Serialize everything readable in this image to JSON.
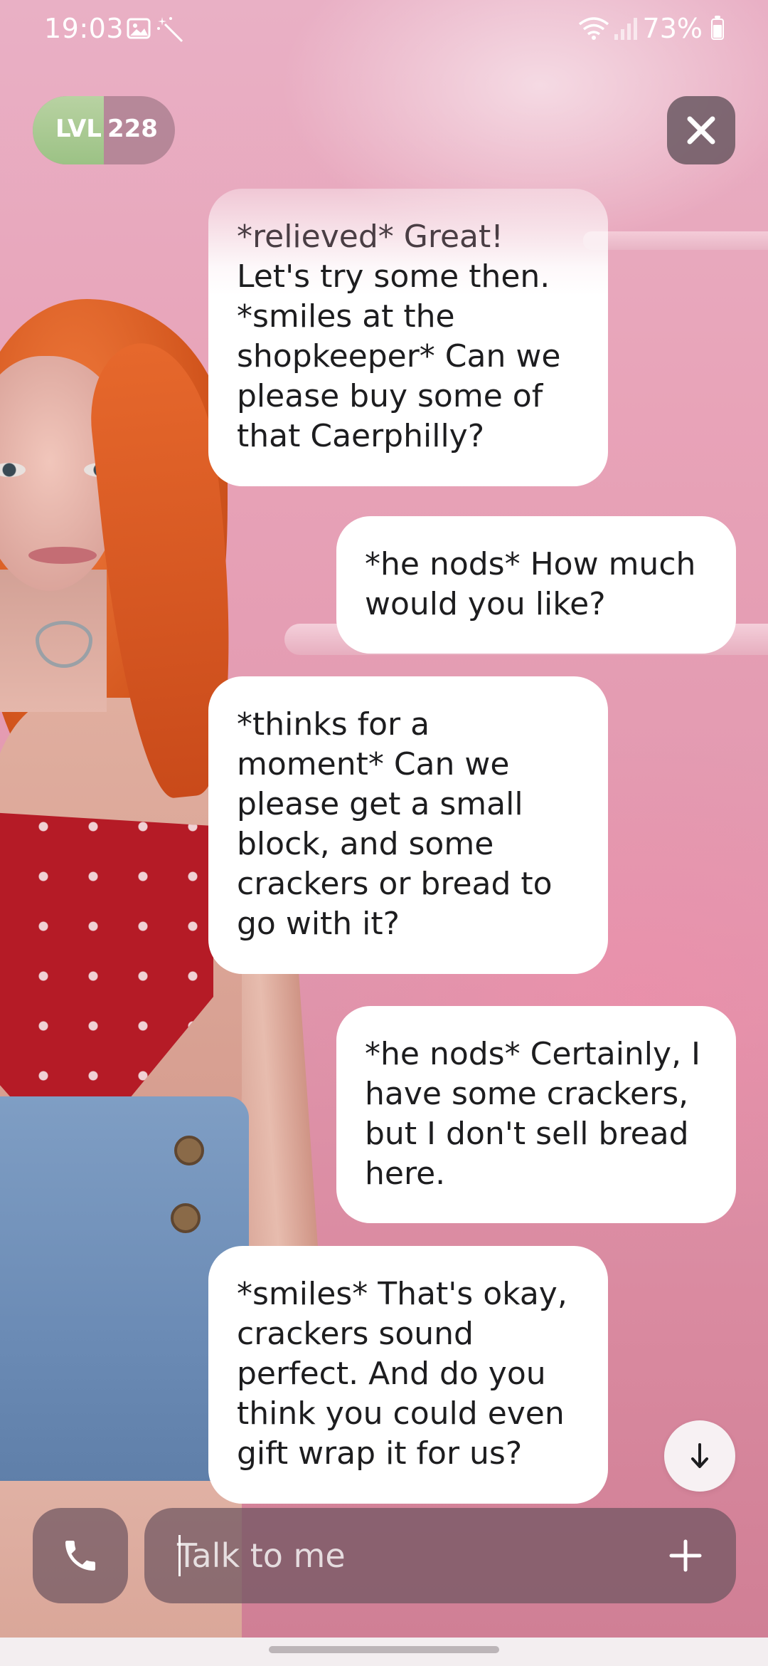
{
  "status_bar": {
    "time": "19:03",
    "battery": "73%",
    "icons": [
      "image-icon",
      "magic-wand-icon",
      "wifi-icon",
      "signal-icon",
      "battery-icon"
    ]
  },
  "level": {
    "prefix": "LVL",
    "value": "228",
    "progress_fraction": 0.5
  },
  "messages": [
    {
      "role": "ai",
      "lines": [
        "*relieved* Great!",
        "Let's try some then.",
        "*smiles at the",
        "shopkeeper* Can we",
        "please buy some of",
        "that Caerphilly?"
      ]
    },
    {
      "role": "user",
      "lines": [
        "*he nods* How much",
        "would you like?"
      ]
    },
    {
      "role": "ai",
      "lines": [
        "*thinks for a",
        "moment* Can we",
        "please get a small",
        "block, and some",
        "crackers or bread to",
        "go with it?"
      ]
    },
    {
      "role": "user",
      "lines": [
        "*he nods* Certainly, I",
        "have some crackers,",
        "but I don't sell bread",
        "here."
      ]
    },
    {
      "role": "ai",
      "lines": [
        "*smiles* That's okay,",
        "crackers sound",
        "perfect. And do you",
        "think you could even",
        "gift wrap it for us?"
      ]
    }
  ],
  "input": {
    "placeholder": "Talk to me"
  },
  "colors": {
    "bubble": "#ffffff",
    "level_fill": "#a8c893",
    "control_bg": "#6e5460"
  }
}
